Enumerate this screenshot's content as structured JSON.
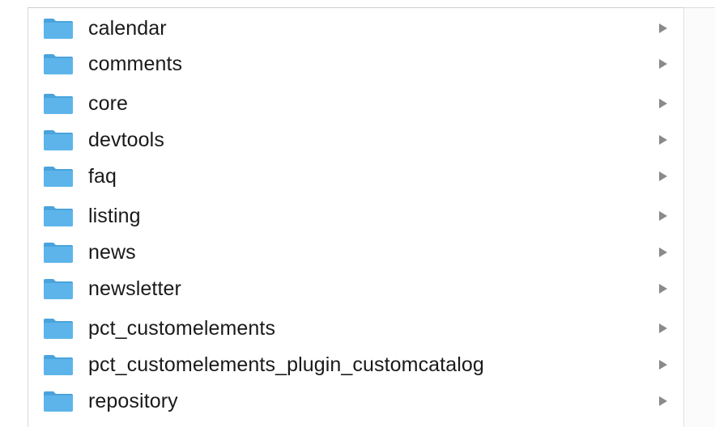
{
  "finder": {
    "items": [
      {
        "label": "calendar",
        "icon": "folder-icon"
      },
      {
        "label": "comments",
        "icon": "folder-icon"
      },
      {
        "label": "core",
        "icon": "folder-icon"
      },
      {
        "label": "devtools",
        "icon": "folder-icon"
      },
      {
        "label": "faq",
        "icon": "folder-icon"
      },
      {
        "label": "listing",
        "icon": "folder-icon"
      },
      {
        "label": "news",
        "icon": "folder-icon"
      },
      {
        "label": "newsletter",
        "icon": "folder-icon"
      },
      {
        "label": "pct_customelements",
        "icon": "folder-icon"
      },
      {
        "label": "pct_customelements_plugin_customcatalog",
        "icon": "folder-icon"
      },
      {
        "label": "repository",
        "icon": "folder-icon"
      }
    ],
    "colors": {
      "folder_body": "#5db4ea",
      "folder_tab": "#4aa3dc",
      "chevron": "#8a8a8a",
      "text": "#1a1a1a"
    }
  }
}
